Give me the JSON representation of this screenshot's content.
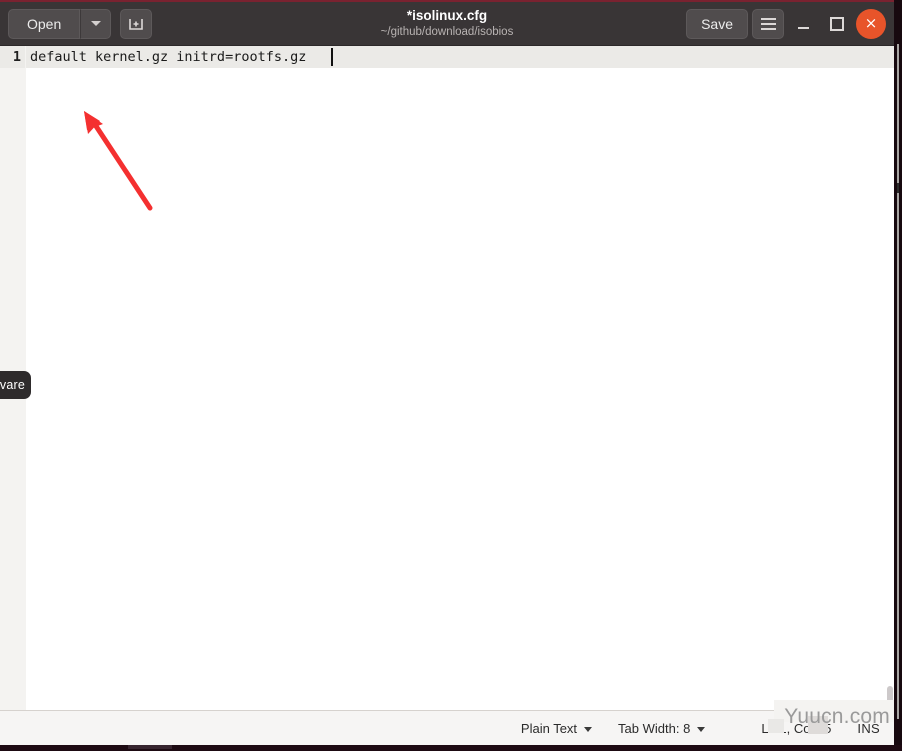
{
  "window": {
    "title": "*isolinux.cfg",
    "subtitle": "~/github/download/isobios"
  },
  "headerbar": {
    "open_label": "Open",
    "open_dropdown_icon": "chevron-down-icon",
    "new_document_icon": "new-document-icon",
    "save_label": "Save",
    "menu_icon": "hamburger-menu-icon",
    "minimize_icon": "minimize-icon",
    "maximize_icon": "maximize-icon",
    "close_icon": "close-icon",
    "close_label": "×"
  },
  "editor": {
    "line_numbers": [
      "1"
    ],
    "lines": [
      "default kernel.gz initrd=rootfs.gz"
    ]
  },
  "annotation": {
    "arrow_color": "#f43030",
    "tooltip_fragment": "vare"
  },
  "statusbar": {
    "language": "Plain Text",
    "tab_width": "Tab Width: 8",
    "position": "Ln 1, Col 35",
    "insert_mode": "INS"
  },
  "watermark": {
    "text": "Yuucn.com"
  },
  "colors": {
    "headerbar_bg": "#393536",
    "button_bg": "#504c4d",
    "close_bg": "#e8542a",
    "editor_bg": "#ffffff",
    "gutter_bg": "#f4f3f1",
    "current_line_bg": "#ebeae7",
    "statusbar_bg": "#f6f5f4",
    "accent_red": "#f43030"
  }
}
